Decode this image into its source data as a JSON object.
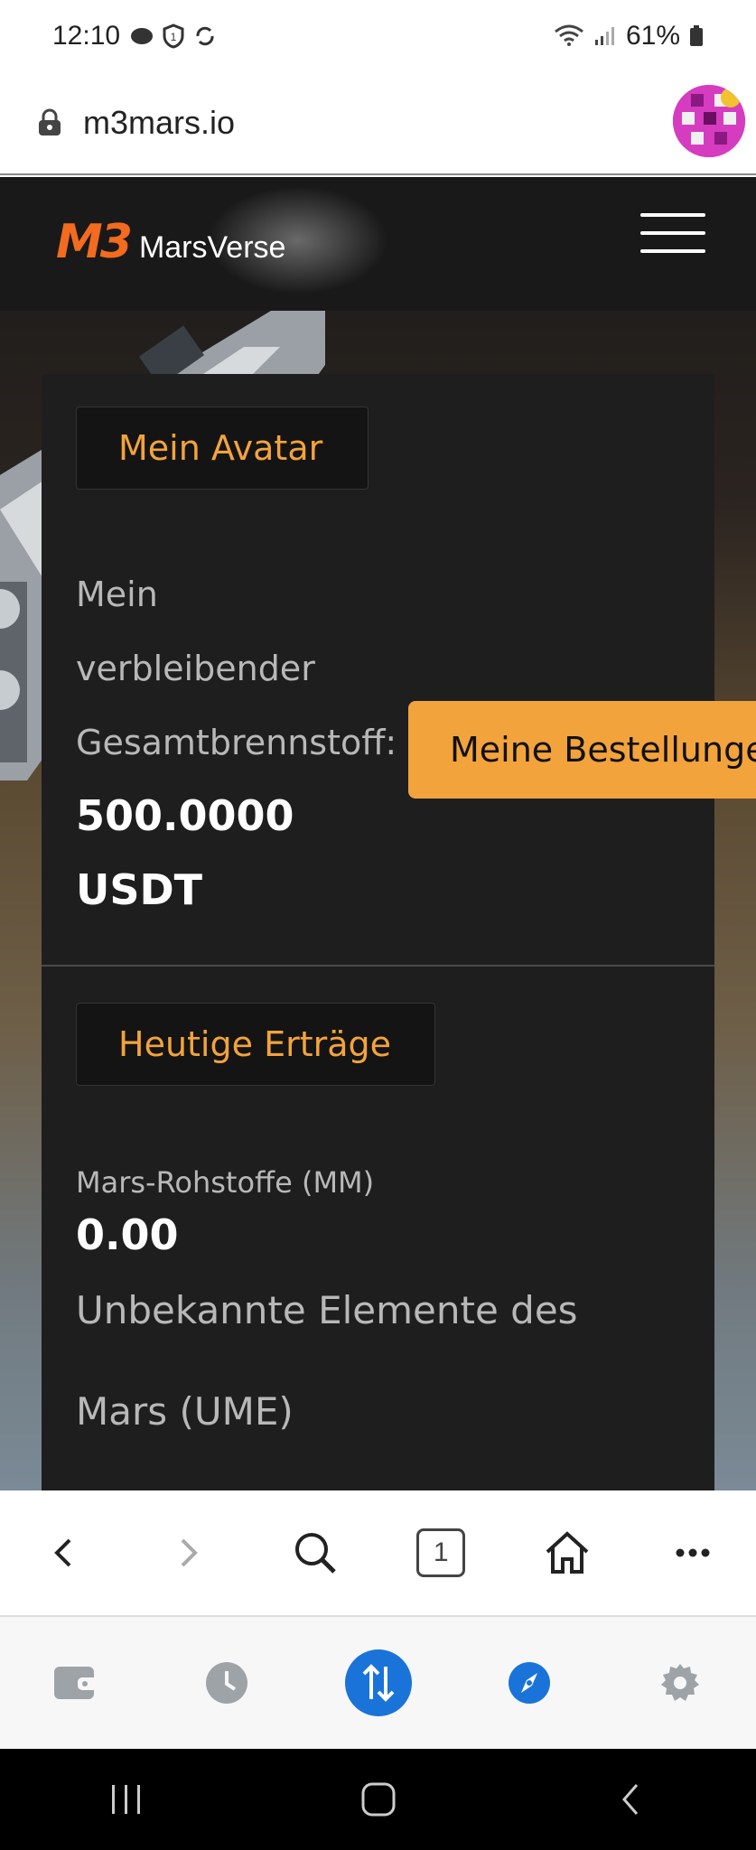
{
  "status_bar": {
    "time": "12:10",
    "battery": "61%"
  },
  "url_bar": {
    "url": "m3mars.io"
  },
  "site": {
    "logo_m3": "M3",
    "logo_text": "MarsVerse"
  },
  "card": {
    "avatar_section": "Mein Avatar",
    "fuel_label_line1": "Mein",
    "fuel_label_line2": "verbleibender",
    "fuel_label_line3": "Gesamtbrennstoff:",
    "fuel_value": "500.0000",
    "fuel_unit": "USDT",
    "earnings_section": "Heutige Erträge",
    "mm_label": "Mars-Rohstoffe (MM)",
    "mm_value": "0.00",
    "ume_label_line1": "Unbekannte Elemente des",
    "ume_label_line2": "Mars (UME)"
  },
  "orders_button": "Meine Bestellungen",
  "toolbar": {
    "tab_count": "1"
  },
  "icons": [
    "lock-icon",
    "hamburger-menu-icon",
    "back-icon",
    "forward-icon",
    "search-icon",
    "tabs-icon",
    "home-icon",
    "more-icon",
    "wallet-icon",
    "history-icon",
    "transfer-icon",
    "explore-icon",
    "settings-icon"
  ],
  "colors": {
    "accent": "#f3a33c",
    "logo": "#f26b1f",
    "card": "#1f1e1e",
    "primary_blue": "#1a73d9"
  }
}
